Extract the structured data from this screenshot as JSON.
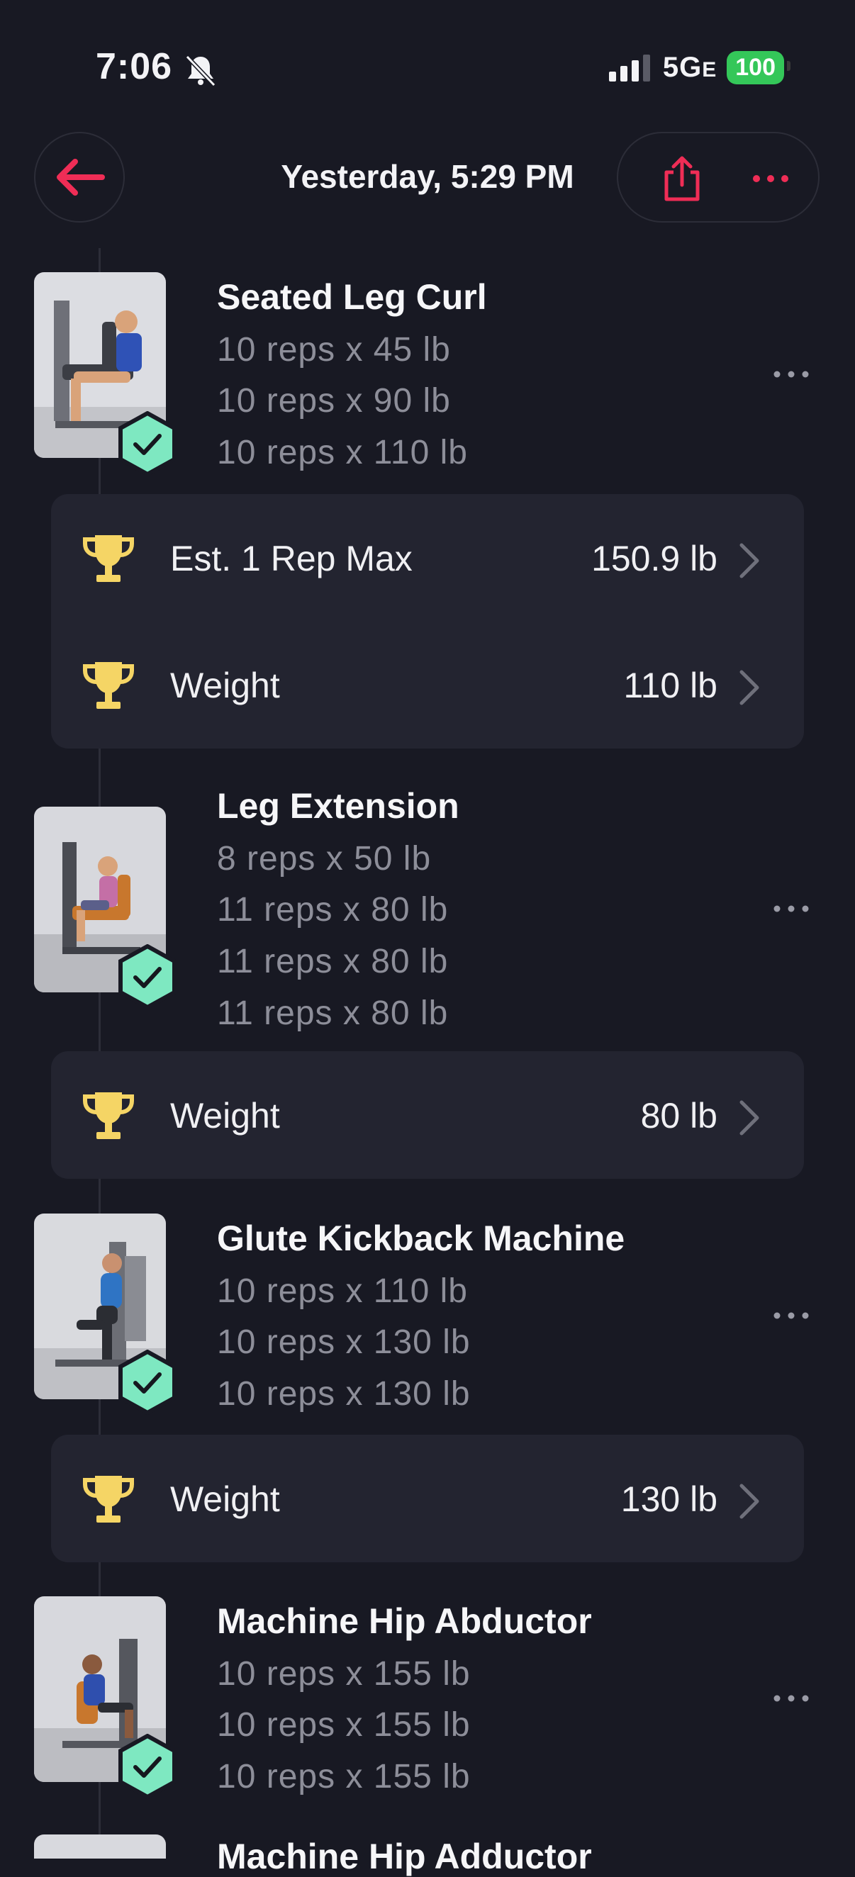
{
  "status_bar": {
    "time": "7:06",
    "network": "5G",
    "network_suffix": "E",
    "battery": "100"
  },
  "header": {
    "title": "Yesterday, 5:29 PM"
  },
  "colors": {
    "accent": "#ef2d56",
    "trophy": "#f5d565",
    "check": "#7ee8c1",
    "background": "#181923",
    "card": "#232430"
  },
  "icons": {
    "back": "arrow-left-icon",
    "share": "share-icon",
    "more": "more-dots-icon",
    "check": "check-badge-icon",
    "trophy": "trophy-icon",
    "chevron": "chevron-right-icon"
  },
  "exercises": [
    {
      "name": "Seated Leg Curl",
      "sets": [
        "10 reps x 45 lb",
        "10 reps x 90 lb",
        "10 reps x 110 lb"
      ],
      "records": [
        {
          "label": "Est. 1 Rep Max",
          "value": "150.9 lb"
        },
        {
          "label": "Weight",
          "value": "110 lb"
        }
      ]
    },
    {
      "name": "Leg Extension",
      "sets": [
        "8 reps x 50 lb",
        "11 reps x 80 lb",
        "11 reps x 80 lb",
        "11 reps x 80 lb"
      ],
      "records": [
        {
          "label": "Weight",
          "value": "80 lb"
        }
      ]
    },
    {
      "name": "Glute Kickback Machine",
      "sets": [
        "10 reps x 110 lb",
        "10 reps x 130 lb",
        "10 reps x 130 lb"
      ],
      "records": [
        {
          "label": "Weight",
          "value": "130 lb"
        }
      ]
    },
    {
      "name": "Machine Hip Abductor",
      "sets": [
        "10 reps x 155 lb",
        "10 reps x 155 lb",
        "10 reps x 155 lb"
      ],
      "records": []
    },
    {
      "name": "Machine Hip Adductor",
      "sets": [],
      "records": []
    }
  ]
}
